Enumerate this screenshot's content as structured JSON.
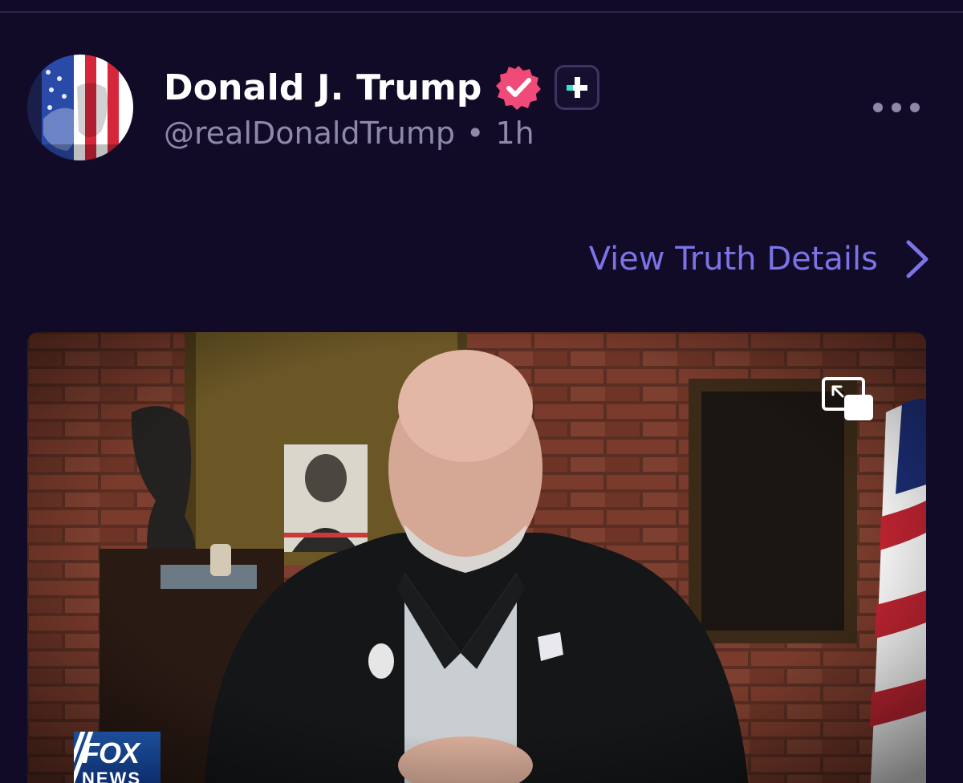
{
  "post": {
    "author_name": "Donald J. Trump",
    "handle": "@realDonaldTrump",
    "separator": "•",
    "time_ago": "1h",
    "verified": true
  },
  "actions": {
    "more_icon": "more-horizontal-icon",
    "plus_icon": "plus-icon",
    "view_details_label": "View Truth Details",
    "view_details_icon": "chevron-right-icon"
  },
  "media": {
    "type": "video",
    "pip_icon": "picture-in-picture-icon",
    "watermark": {
      "top": "FOX",
      "bottom": "NEWS"
    }
  },
  "colors": {
    "background": "#110b28",
    "accent_link": "#7b73e6",
    "verified_badge": "#f04a78",
    "secondary_text": "#8e89a8"
  }
}
